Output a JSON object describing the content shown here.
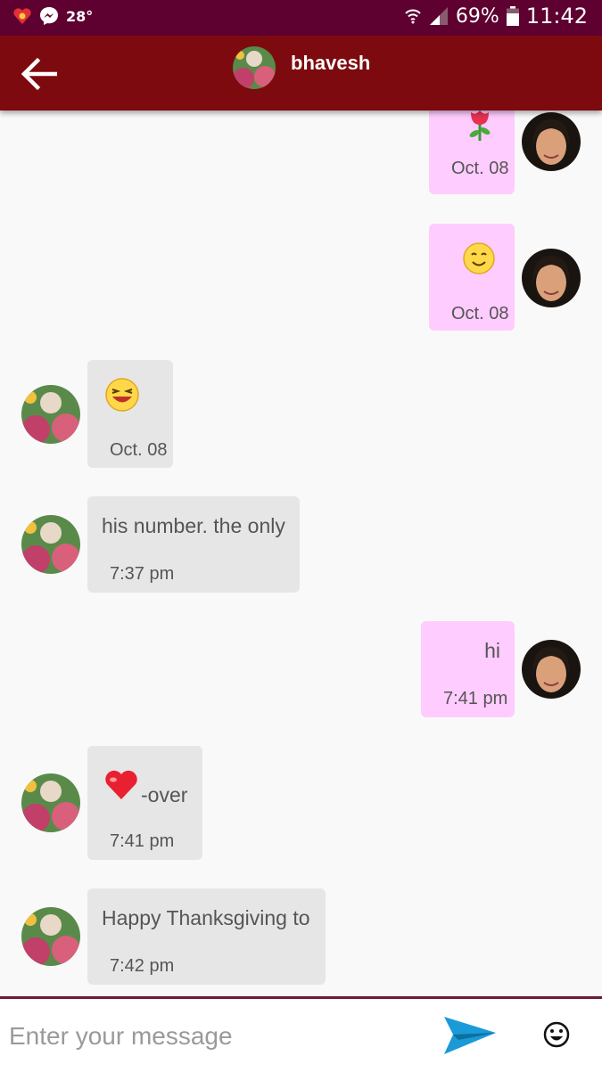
{
  "status_bar": {
    "temperature": "28°",
    "battery_percent": "69%",
    "time": "11:42",
    "icons": [
      "heart-flower-icon",
      "messenger-icon",
      "wifi-icon",
      "signal-icon",
      "battery-icon"
    ]
  },
  "header": {
    "contact_name": "bhavesh",
    "back_icon": "back-arrow-icon"
  },
  "messages": [
    {
      "direction": "sent",
      "emoji": "rose-emoji",
      "text": "",
      "time": "Oct. 08"
    },
    {
      "direction": "sent",
      "emoji": "smile-emoji",
      "text": "",
      "time": "Oct. 08"
    },
    {
      "direction": "received",
      "emoji": "laugh-emoji",
      "text": "",
      "time": "Oct. 08"
    },
    {
      "direction": "received",
      "emoji": "",
      "text": "his number. the only",
      "time": "7:37 pm"
    },
    {
      "direction": "sent",
      "emoji": "",
      "text": "hi",
      "time": "7:41 pm"
    },
    {
      "direction": "received",
      "emoji": "heart-emoji",
      "text": "-over",
      "time": "7:41 pm"
    },
    {
      "direction": "received",
      "emoji": "",
      "text": "Happy Thanksgiving to",
      "time": "7:42 pm"
    }
  ],
  "composer": {
    "placeholder": "Enter your message",
    "value": ""
  },
  "colors": {
    "status_bar": "#5e0030",
    "top_bar": "#7d0a0e",
    "sent_bubble": "#ffccff",
    "received_bubble": "#e6e6e6",
    "send_icon": "#1a9ad6"
  }
}
